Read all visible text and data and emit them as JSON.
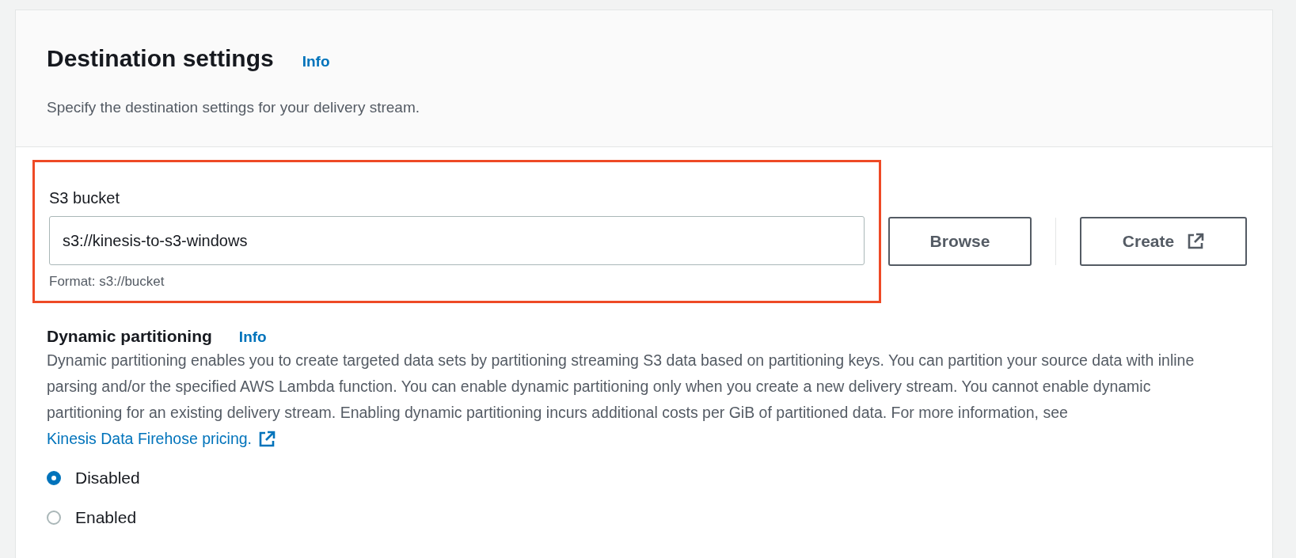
{
  "header": {
    "title": "Destination settings",
    "info_link": "Info",
    "description": "Specify the destination settings for your delivery stream."
  },
  "s3_bucket": {
    "label": "S3 bucket",
    "value": "s3://kinesis-to-s3-windows",
    "hint": "Format: s3://bucket",
    "highlighted": true
  },
  "buttons": [
    {
      "label": "Browse",
      "kind": "plain"
    },
    {
      "label": "Create",
      "kind": "external"
    }
  ],
  "dynamic_partitioning": {
    "title": "Dynamic partitioning",
    "info_link": "Info",
    "description": "Dynamic partitioning enables you to create targeted data sets by partitioning streaming S3 data based on partitioning keys. You can partition your source data with inline parsing and/or the specified AWS Lambda function. You can enable dynamic partitioning only when you create a new delivery stream. You cannot enable dynamic partitioning for an existing delivery stream. Enabling dynamic partitioning incurs additional costs per GiB of partitioned data. For more information, see ",
    "link": "Kinesis Data Firehose pricing.",
    "options": [
      {
        "label": "Disabled",
        "selected": true
      },
      {
        "label": "Enabled",
        "selected": false
      }
    ]
  }
}
